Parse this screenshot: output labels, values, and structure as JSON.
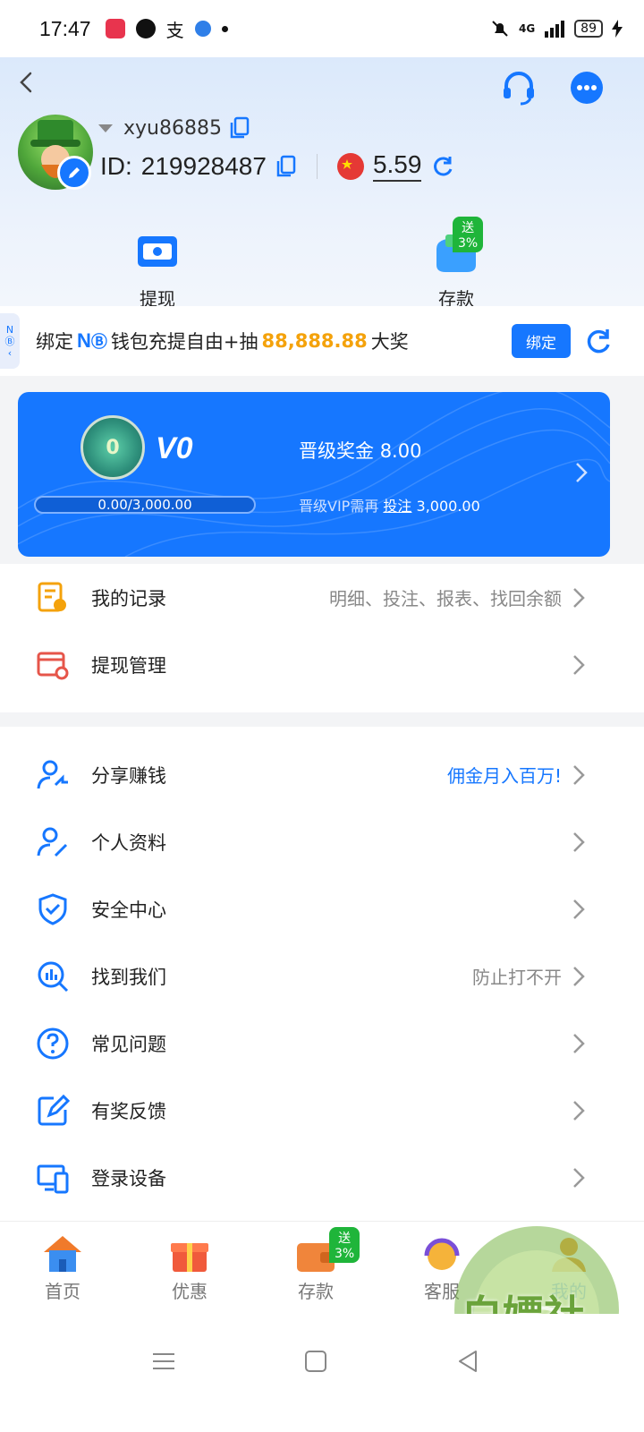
{
  "status": {
    "time": "17:47",
    "apps": [
      "music-app-icon",
      "telegram-icon",
      "alipay-icon",
      "app-icon"
    ],
    "network": "4G",
    "battery": "89"
  },
  "header": {
    "username": "xyu86885",
    "id_label": "ID:",
    "id_value": "219928487",
    "balance": "5.59",
    "quick_actions": [
      {
        "label": "提现",
        "icon": "withdraw-icon"
      },
      {
        "label": "存款",
        "icon": "deposit-wallet-icon",
        "badge": "送3%"
      }
    ]
  },
  "bind_banner": {
    "side_tab": "N",
    "text_before": "绑定",
    "brand": "N",
    "text_middle": "钱包充提自由+抽",
    "prize_amount": "88,888.88",
    "text_after": "大奖",
    "button_label": "绑定"
  },
  "vip": {
    "level": "V0",
    "medal_label": "0",
    "progress_text": "0.00/3,000.00",
    "progress_fraction": 0.0,
    "bonus_label": "晋级奖金",
    "bonus_value": "8.00",
    "need_label": "晋级VIP需再",
    "need_link": "投注",
    "need_amount": "3,000.00"
  },
  "menu_group1": [
    {
      "label": "我的记录",
      "hint": "明细、投注、报表、找回余额",
      "icon": "records-icon"
    },
    {
      "label": "提现管理",
      "hint": "",
      "icon": "withdraw-manage-icon"
    }
  ],
  "menu_group2": [
    {
      "label": "分享赚钱",
      "hint": "佣金月入百万!",
      "icon": "share-user-icon"
    },
    {
      "label": "个人资料",
      "hint": "",
      "icon": "profile-edit-icon"
    },
    {
      "label": "安全中心",
      "hint": "",
      "icon": "shield-icon"
    },
    {
      "label": "找到我们",
      "hint": "防止打不开",
      "icon": "search-chart-icon"
    },
    {
      "label": "常见问题",
      "hint": "",
      "icon": "question-icon"
    },
    {
      "label": "有奖反馈",
      "hint": "",
      "icon": "feedback-edit-icon"
    },
    {
      "label": "登录设备",
      "hint": "",
      "icon": "devices-icon"
    }
  ],
  "tabbar": [
    {
      "label": "首页",
      "icon": "home-icon"
    },
    {
      "label": "优惠",
      "icon": "gift-icon"
    },
    {
      "label": "存款",
      "icon": "wallet-icon",
      "badge": "送3%"
    },
    {
      "label": "客服",
      "icon": "support-headset-icon"
    },
    {
      "label": "我的",
      "icon": "profile-icon"
    }
  ],
  "watermark": {
    "text": "白嫖社"
  },
  "colors": {
    "accent": "#1677ff",
    "prize": "#f4a20b",
    "badge": "#1fb53a"
  }
}
